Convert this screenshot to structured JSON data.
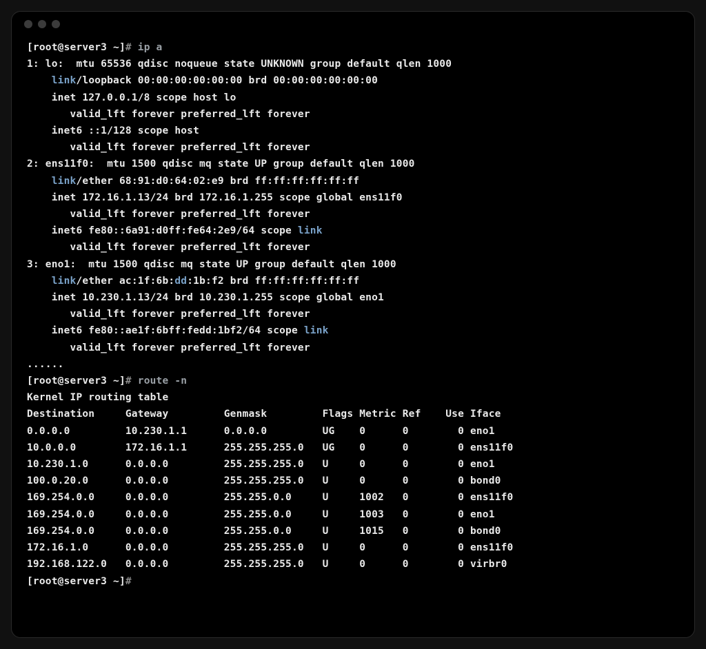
{
  "prompts": {
    "p1_prefix": "[root@server3 ~]",
    "p1_hash": "#",
    "p1_cmd": " ip a",
    "p2_prefix": "[root@server3 ~]",
    "p2_hash": "#",
    "p2_cmd": " route -n",
    "p3_prefix": "[root@server3 ~]",
    "p3_hash": "#"
  },
  "ip_a": {
    "l1": "1: lo:  mtu 65536 qdisc noqueue state UNKNOWN group default qlen 1000",
    "l2a": "    ",
    "l2_kw": "link",
    "l2b": "/loopback 00:00:00:00:00:00 brd 00:00:00:00:00:00",
    "l3": "    inet 127.0.0.1/8 scope host lo",
    "l4": "       valid_lft forever preferred_lft forever",
    "l5": "    inet6 ::1/128 scope host",
    "l6": "       valid_lft forever preferred_lft forever",
    "l7": "2: ens11f0:  mtu 1500 qdisc mq state UP group default qlen 1000",
    "l8a": "    ",
    "l8_kw": "link",
    "l8b": "/ether 68:91:d0:64:02:e9 brd ff:ff:ff:ff:ff:ff",
    "l9": "    inet 172.16.1.13/24 brd 172.16.1.255 scope global ens11f0",
    "l10": "       valid_lft forever preferred_lft forever",
    "l11a": "    inet6 fe80::6a91:d0ff:fe64:2e9/64 scope ",
    "l11_kw": "link",
    "l12": "       valid_lft forever preferred_lft forever",
    "l13": "3: eno1:  mtu 1500 qdisc mq state UP group default qlen 1000",
    "l14a": "    ",
    "l14_kw": "link",
    "l14b": "/ether ac:1f:6b:",
    "l14_kw2": "dd",
    "l14c": ":1b:f2 brd ff:ff:ff:ff:ff:ff",
    "l15": "    inet 10.230.1.13/24 brd 10.230.1.255 scope global eno1",
    "l16": "       valid_lft forever preferred_lft forever",
    "l17a": "    inet6 fe80::ae1f:6bff:fedd:1bf2/64 scope ",
    "l17_kw": "link",
    "l18": "       valid_lft forever preferred_lft forever",
    "dots": "......"
  },
  "route": {
    "title": "Kernel IP routing table",
    "hdr": "Destination     Gateway         Genmask         Flags Metric Ref    Use Iface",
    "rows": [
      "0.0.0.0         10.230.1.1      0.0.0.0         UG    0      0        0 eno1",
      "10.0.0.0        172.16.1.1      255.255.255.0   UG    0      0        0 ens11f0",
      "10.230.1.0      0.0.0.0         255.255.255.0   U     0      0        0 eno1",
      "100.0.20.0      0.0.0.0         255.255.255.0   U     0      0        0 bond0",
      "169.254.0.0     0.0.0.0         255.255.0.0     U     1002   0        0 ens11f0",
      "169.254.0.0     0.0.0.0         255.255.0.0     U     1003   0        0 eno1",
      "169.254.0.0     0.0.0.0         255.255.0.0     U     1015   0        0 bond0",
      "172.16.1.0      0.0.0.0         255.255.255.0   U     0      0        0 ens11f0",
      "192.168.122.0   0.0.0.0         255.255.255.0   U     0      0        0 virbr0"
    ]
  }
}
